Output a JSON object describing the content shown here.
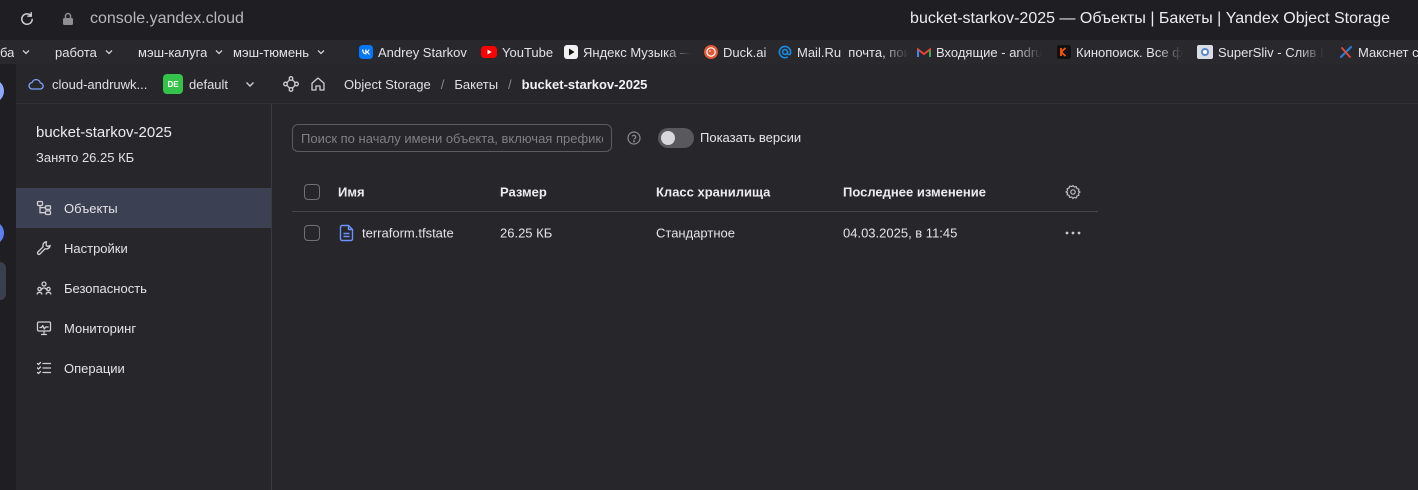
{
  "browser": {
    "url": "console.yandex.cloud",
    "window_title": "bucket-starkov-2025 — Объекты | Бакеты | Yandex Object Storage",
    "bookmarks": [
      {
        "label": "ба",
        "icon": "chevron-down-icon"
      },
      {
        "label": "работа",
        "icon": "chevron-down-icon"
      },
      {
        "label": "мэш-калуга",
        "icon": "chevron-down-icon"
      },
      {
        "label": "мэш-тюмень",
        "icon": "chevron-down-icon"
      },
      {
        "label": "Andrey Starkov",
        "icon": "vk-icon"
      },
      {
        "label": "YouTube",
        "icon": "youtube-icon"
      },
      {
        "label": "Яндекс Музыка —",
        "icon": "yandex-music-icon"
      },
      {
        "label": "Duck.ai",
        "icon": "duckduckgo-icon"
      },
      {
        "label": "Mail.Ru  почта, пои",
        "icon": "mailru-icon"
      },
      {
        "label": "Входящие - andru",
        "icon": "gmail-icon"
      },
      {
        "label": "Кинопоиск. Все ф",
        "icon": "kinopoisk-icon"
      },
      {
        "label": "SuperSliv - Слив I",
        "icon": "supersliv-icon"
      },
      {
        "label": "Макснет сто",
        "icon": "maknet-icon"
      }
    ]
  },
  "app_header": {
    "cloud_name": "cloud-andruwk...",
    "folder_badge": "DE",
    "folder_name": "default",
    "separator": "/",
    "breadcrumbs": [
      "Object Storage",
      "Бакеты",
      "bucket-starkov-2025"
    ]
  },
  "sidebar": {
    "bucket_name": "bucket-starkov-2025",
    "usage": "Занято 26.25 КБ",
    "items": [
      {
        "label": "Объекты",
        "icon": "objects-icon",
        "active": true
      },
      {
        "label": "Настройки",
        "icon": "wrench-icon",
        "active": false
      },
      {
        "label": "Безопасность",
        "icon": "users-icon",
        "active": false
      },
      {
        "label": "Мониторинг",
        "icon": "monitoring-icon",
        "active": false
      },
      {
        "label": "Операции",
        "icon": "operations-icon",
        "active": false
      }
    ]
  },
  "toolbar": {
    "search_placeholder": "Поиск по началу имени объекта, включая префикс",
    "show_versions_label": "Показать версии",
    "show_versions_enabled": false
  },
  "table": {
    "columns": [
      "Имя",
      "Размер",
      "Класс хранилища",
      "Последнее изменение"
    ],
    "all_selected": false,
    "rows": [
      {
        "name": "terraform.tfstate",
        "size": "26.25 КБ",
        "storage_class": "Стандартное",
        "modified": "04.03.2025, в 11:45",
        "selected": false,
        "icon": "file-icon"
      }
    ]
  },
  "colors": {
    "folder_badge": "#35c24a",
    "active_item_bg": "#3b4052",
    "file_icon": "#6b93ff",
    "cloud_icon": "#7fa6ff"
  }
}
